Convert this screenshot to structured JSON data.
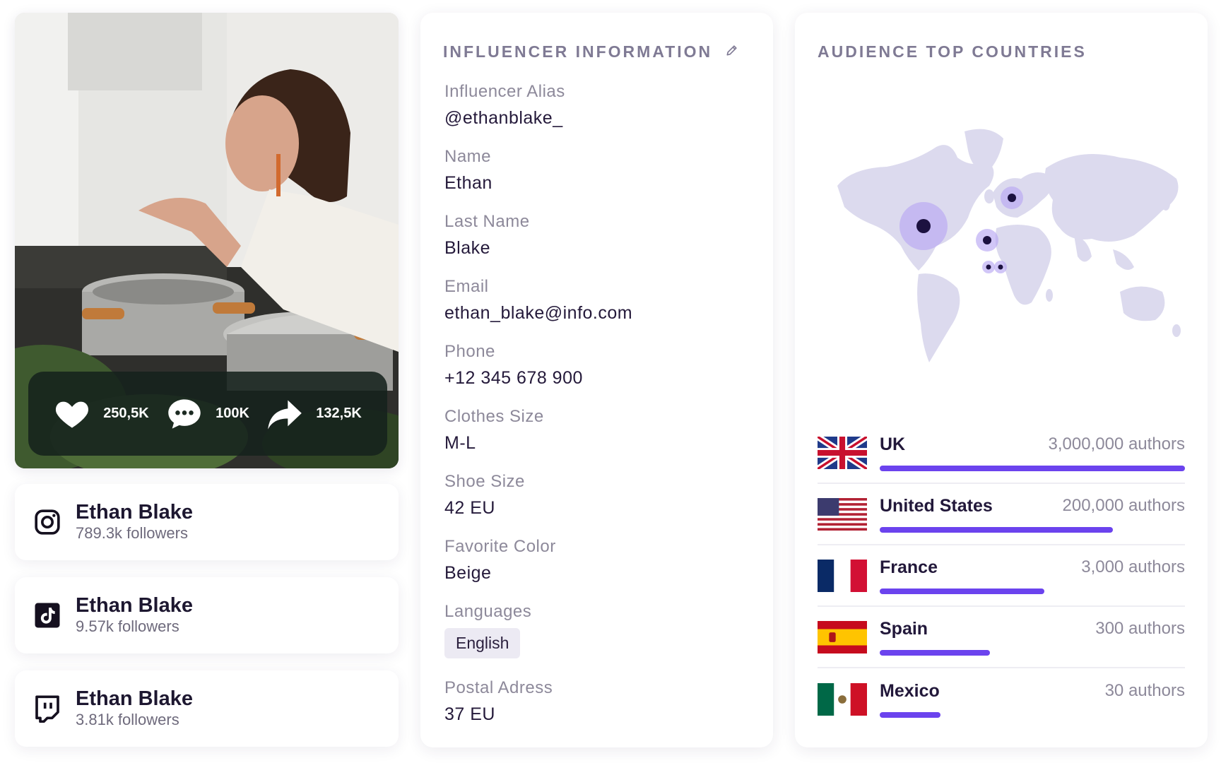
{
  "post": {
    "likes": "250,5K",
    "comments": "100K",
    "shares": "132,5K"
  },
  "socials": [
    {
      "network": "instagram",
      "icon": "instagram-icon",
      "name": "Ethan Blake",
      "followers": "789.3k followers"
    },
    {
      "network": "tiktok",
      "icon": "tiktok-icon",
      "name": "Ethan Blake",
      "followers": "9.57k followers"
    },
    {
      "network": "twitch",
      "icon": "twitch-icon",
      "name": "Ethan Blake",
      "followers": "3.81k followers"
    }
  ],
  "influencer_info": {
    "title": "INFLUENCER INFORMATION",
    "edit_icon": "pencil-icon",
    "fields": [
      {
        "label": "Influencer Alias",
        "value": "@ethanblake_"
      },
      {
        "label": "Name",
        "value": "Ethan"
      },
      {
        "label": "Last Name",
        "value": "Blake"
      },
      {
        "label": "Email",
        "value": "ethan_blake@info.com"
      },
      {
        "label": "Phone",
        "value": "+12 345 678 900"
      },
      {
        "label": "Clothes Size",
        "value": "M-L"
      },
      {
        "label": "Shoe Size",
        "value": "42 EU"
      },
      {
        "label": "Favorite Color",
        "value": "Beige"
      }
    ],
    "languages": {
      "label": "Languages",
      "values": [
        "English"
      ]
    },
    "postal": {
      "label": "Postal Adress",
      "value": "37 EU"
    }
  },
  "audience": {
    "title": "AUDIENCE TOP COUNTRIES",
    "bar_color": "#6b43ee",
    "countries": [
      {
        "name": "UK",
        "count": "3,000,000 authors",
        "share": 1.0,
        "flag": "uk-flag"
      },
      {
        "name": "United States",
        "count": "200,000 authors",
        "share": 0.765,
        "flag": "us-flag"
      },
      {
        "name": "France",
        "count": "3,000 authors",
        "share": 0.54,
        "flag": "france-flag"
      },
      {
        "name": "Spain",
        "count": "300 authors",
        "share": 0.36,
        "flag": "spain-flag"
      },
      {
        "name": "Mexico",
        "count": "30 authors",
        "share": 0.2,
        "flag": "mexico-flag"
      }
    ]
  }
}
